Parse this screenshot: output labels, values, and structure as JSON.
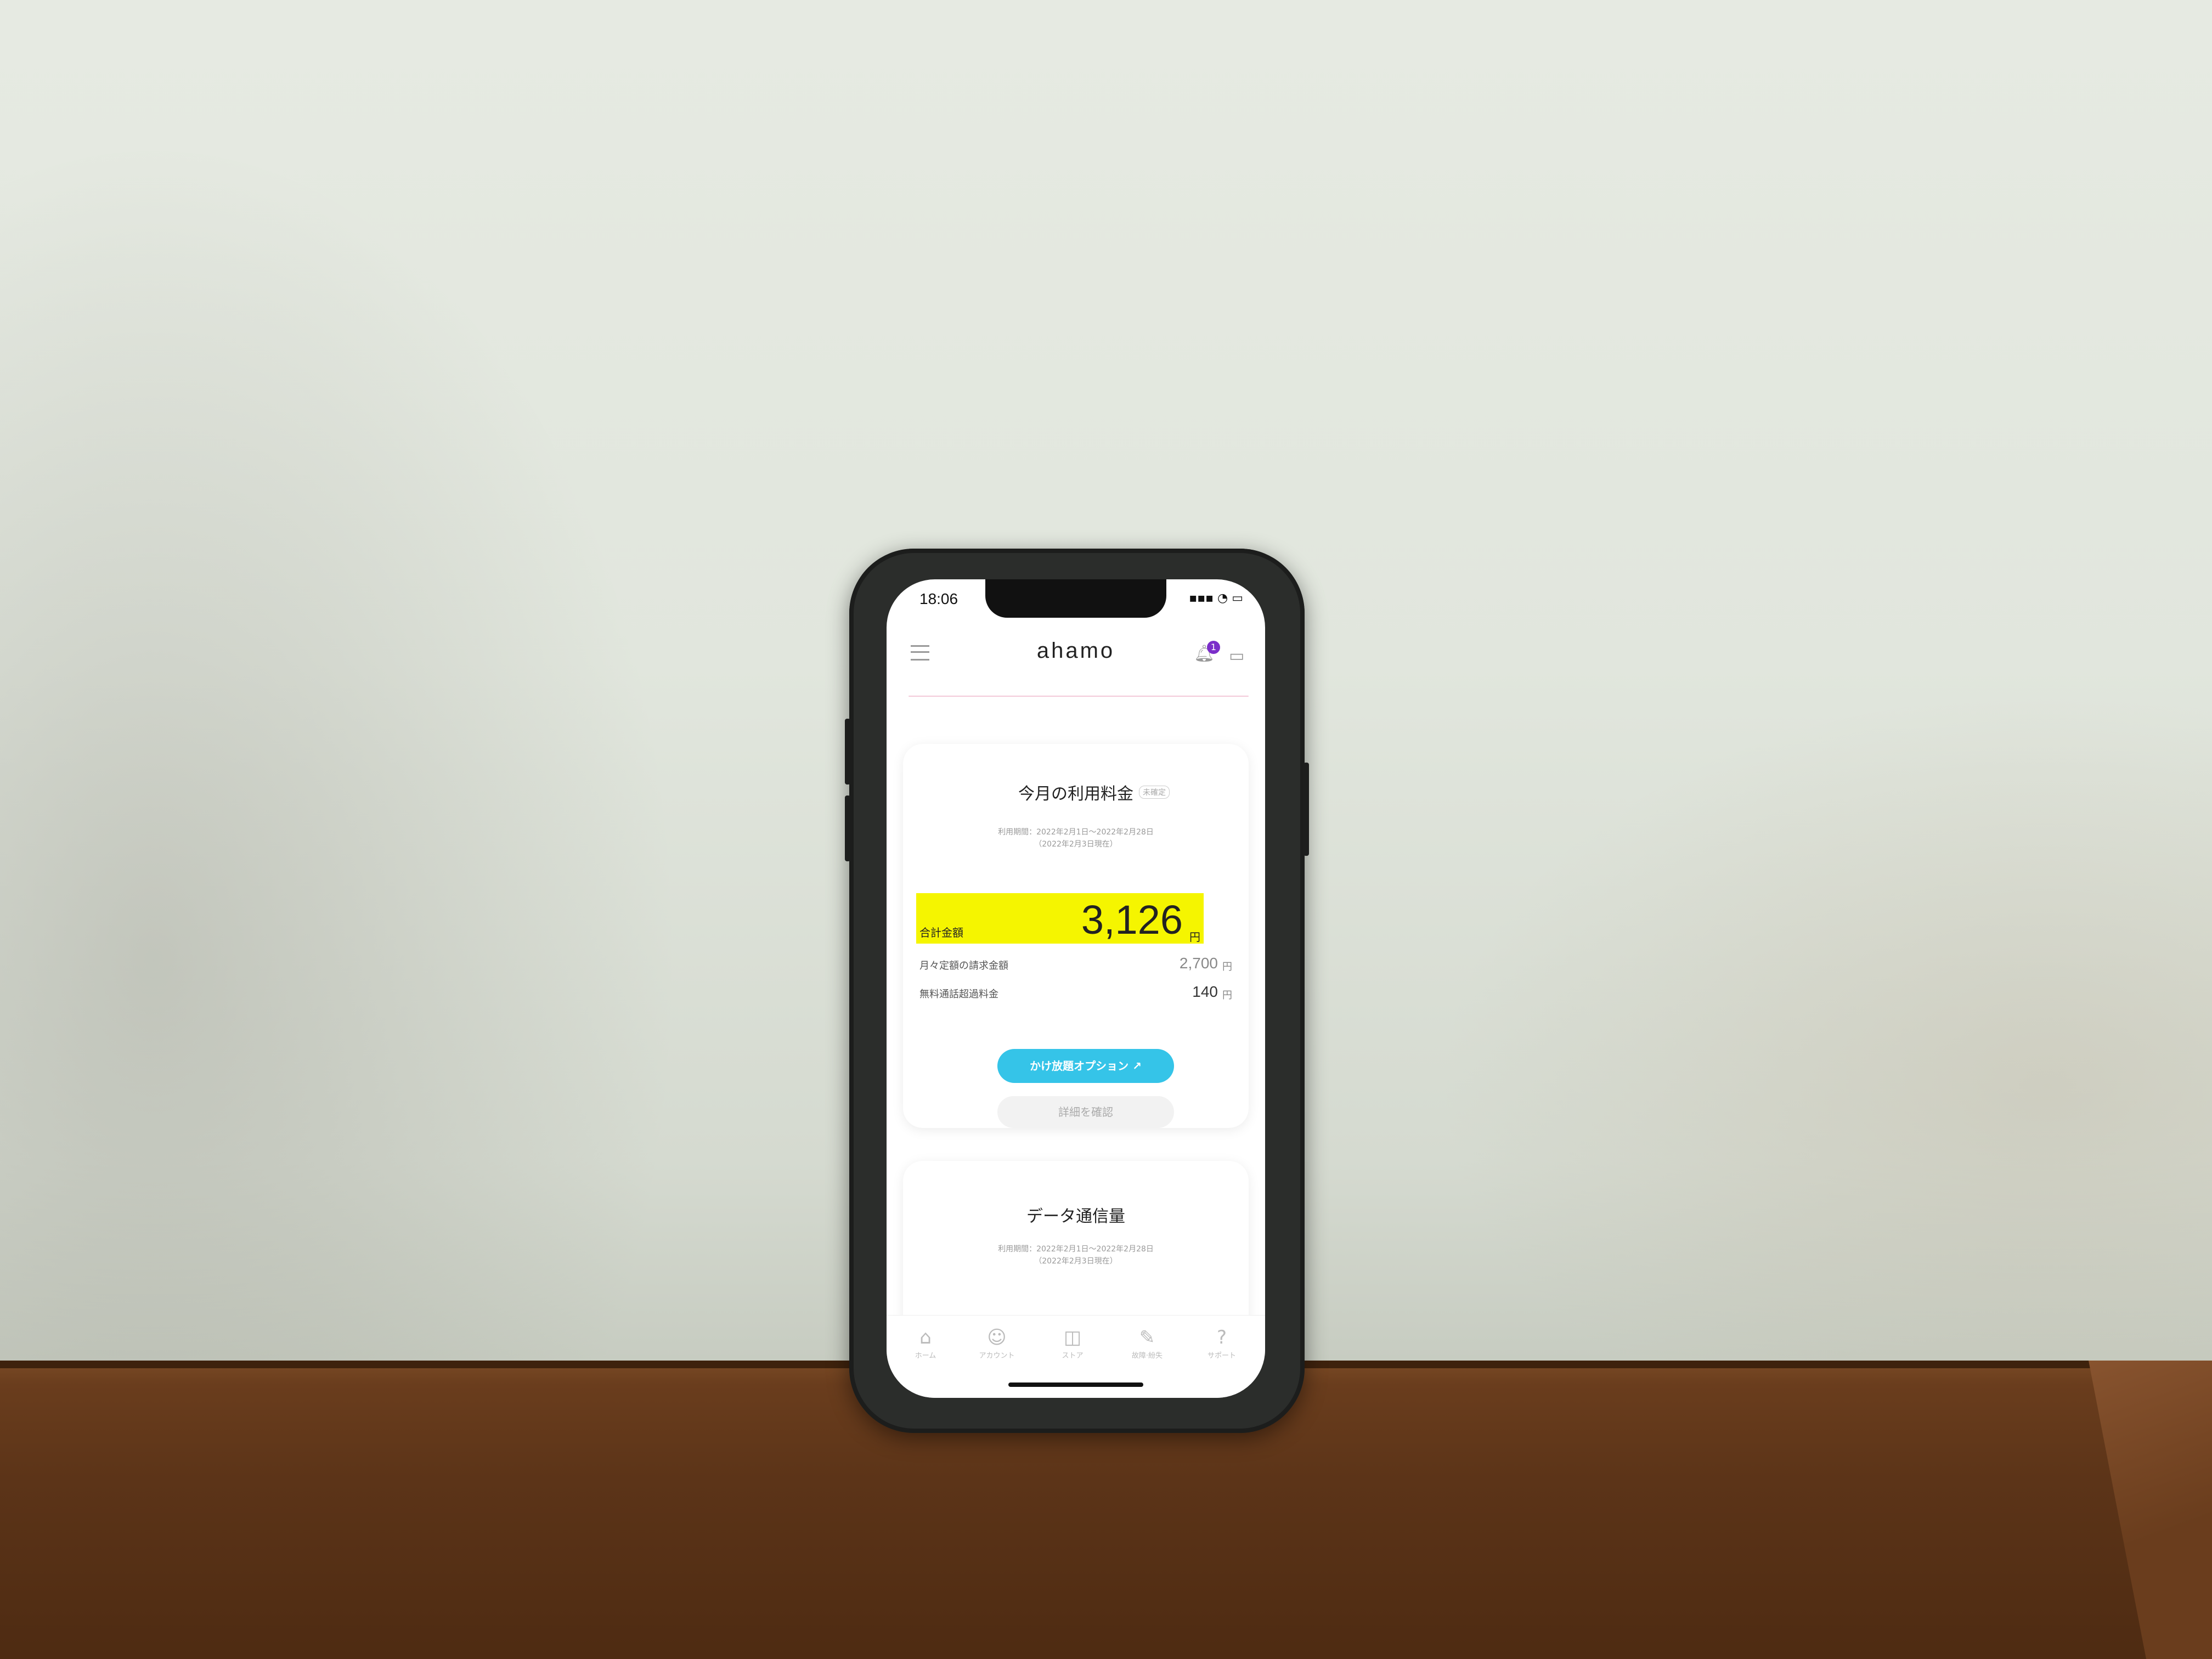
{
  "status_bar": {
    "time": "18:06",
    "icons": "▪▪▪ ◔ ▭"
  },
  "header": {
    "logo": "ahamo",
    "notification_count": "1",
    "bell_icon": "bell-icon",
    "chat_icon": "chat-icon",
    "menu_icon": "menu-icon"
  },
  "fee": {
    "title": "今月の利用料金",
    "status_tag": "未確定",
    "period": "利用期間：2022年2月1日〜2022年2月28日",
    "as_of": "（2022年2月3日現在）",
    "total_label": "合計金額",
    "total_value": "3,126",
    "unit": "円",
    "rows": [
      {
        "label": "月々定額の請求金額",
        "value": "2,700",
        "unit": "円"
      },
      {
        "label": "無料通話超過料金",
        "value": "140",
        "unit": "円"
      }
    ],
    "primary_button": "かけ放題オプション ↗",
    "secondary_button": "詳細を確認"
  },
  "data_usage": {
    "title": "データ通信量",
    "period": "利用期間：2022年2月1日〜2022年2月28日",
    "as_of": "（2022年2月3日現在）"
  },
  "tabs": [
    {
      "label": "ホーム",
      "icon": "⌂"
    },
    {
      "label": "アカウント",
      "icon": "☺"
    },
    {
      "label": "ストア",
      "icon": "◫"
    },
    {
      "label": "故障·紛失",
      "icon": "✎"
    },
    {
      "label": "サポート",
      "icon": "?"
    }
  ]
}
